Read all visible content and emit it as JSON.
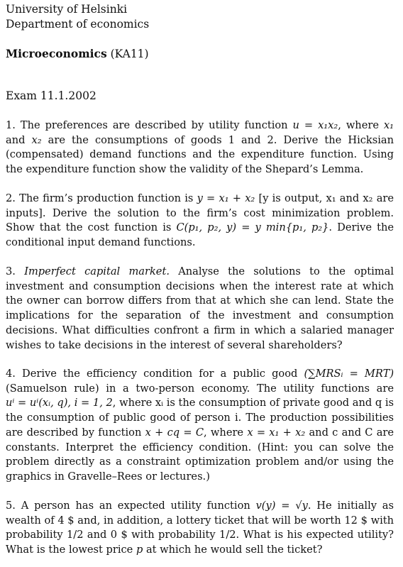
{
  "header": {
    "university": "University of Helsinki",
    "department": "Department of economics"
  },
  "course": {
    "name": "Microeconomics",
    "code": "(KA11)"
  },
  "exam_title": "Exam 11.1.2002",
  "questions": {
    "q1": {
      "s1": "1. The preferences are described by utility function",
      "math1": "u = x₁x₂",
      "s2": ", where",
      "math2": "x₁",
      "s3": "and",
      "math3": "x₂",
      "s4": "are the consumptions of goods 1 and 2. Derive the Hicksian (compensated) demand functions and the expenditure function. Using the expenditure function show the validity of the Shepard’s Lemma."
    },
    "q2": {
      "s1": "2. The firm’s production function is",
      "math1": "y = x₁ + x₂",
      "s2": "[y is output, x₁ and x₂ are inputs]. Derive the solution to the firm’s cost minimization problem. Show that the cost function is",
      "math2": "C(p₁, p₂, y) = y min{p₁, p₂}",
      "s3": ". Derive the conditional input demand functions."
    },
    "q3": {
      "s1": "3.",
      "title": "Imperfect capital market.",
      "s2": "Analyse the solutions to the optimal investment and consumption decisions when the interest rate at which the owner can borrow differs from that at which she can lend. State the implications for the separation of the investment and consumption decisions. What difficulties confront a firm in which a salaried manager wishes to take decisions in the interest of several shareholders?"
    },
    "q4": {
      "s1": "4. Derive the efficiency condition for a public good",
      "math1": "(∑MRSᵢ = MRT)",
      "s2": "(Samuelson rule) in a two-person economy. The utility functions are",
      "math2": "uⁱ = uⁱ(xᵢ, q), i = 1, 2",
      "s3": ", where xᵢ is the consumption of private good and q is the consumption of public good of person i. The production possibilities are described by function",
      "math3": "x + cq = C",
      "s4": ", where",
      "math4": "x = x₁ + x₂",
      "s5": "and c and C are constants. Interpret the efficiency condition. (Hint: you can solve the problem directly as a constraint optimization problem and/or using the graphics in Gravelle–Rees or lectures.)"
    },
    "q5": {
      "s1": "5. A person has an expected utility function",
      "math1": "v(y) = √y",
      "s2": ". He initially as wealth of 4 $ and, in addition, a lottery ticket that will be worth 12 $ with probability 1/2 and 0 $ with probability 1/2. What is his expected utility? What is the lowest price",
      "math2": "p",
      "s3": "at which he would sell the ticket?"
    }
  }
}
